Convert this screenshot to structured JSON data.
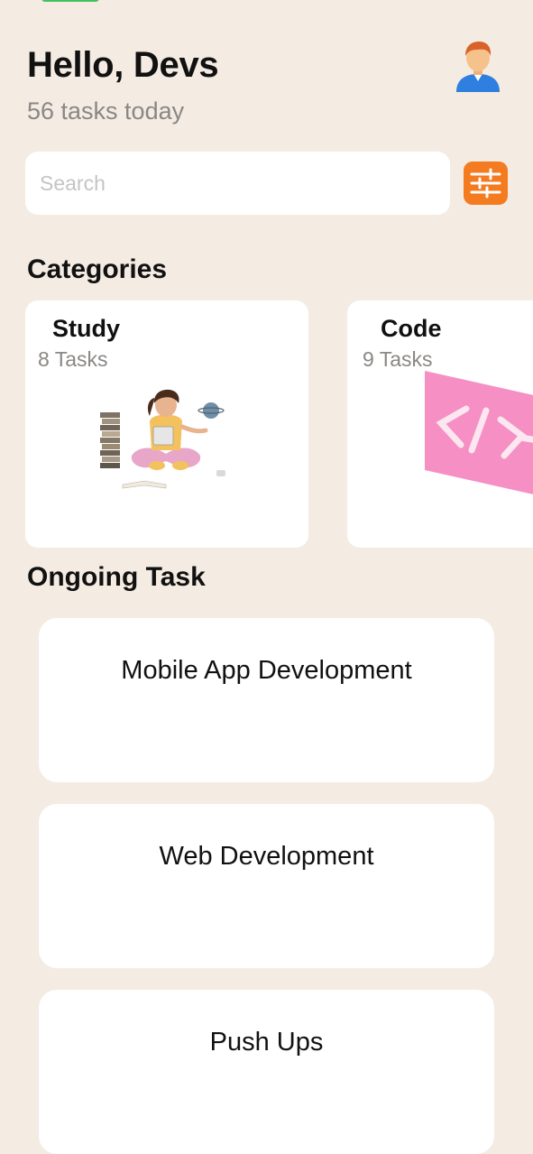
{
  "header": {
    "greeting": "Hello, Devs",
    "subtitle": "56 tasks today"
  },
  "search": {
    "placeholder": "Search",
    "value": ""
  },
  "categories": {
    "title": "Categories",
    "items": [
      {
        "name": "Study",
        "count": "8 Tasks",
        "icon": "study-illustration-icon"
      },
      {
        "name": "Code",
        "count": "9 Tasks",
        "icon": "code-brackets-icon"
      }
    ]
  },
  "ongoing": {
    "title": "Ongoing Task",
    "tasks": [
      {
        "title": "Mobile App Development"
      },
      {
        "title": "Web Development"
      },
      {
        "title": "Push Ups"
      }
    ]
  },
  "colors": {
    "background": "#F4EBE2",
    "accent": "#F47B20",
    "card": "#FFFFFF",
    "muted_text": "#8A8784",
    "code_pink": "#F58FC4"
  }
}
